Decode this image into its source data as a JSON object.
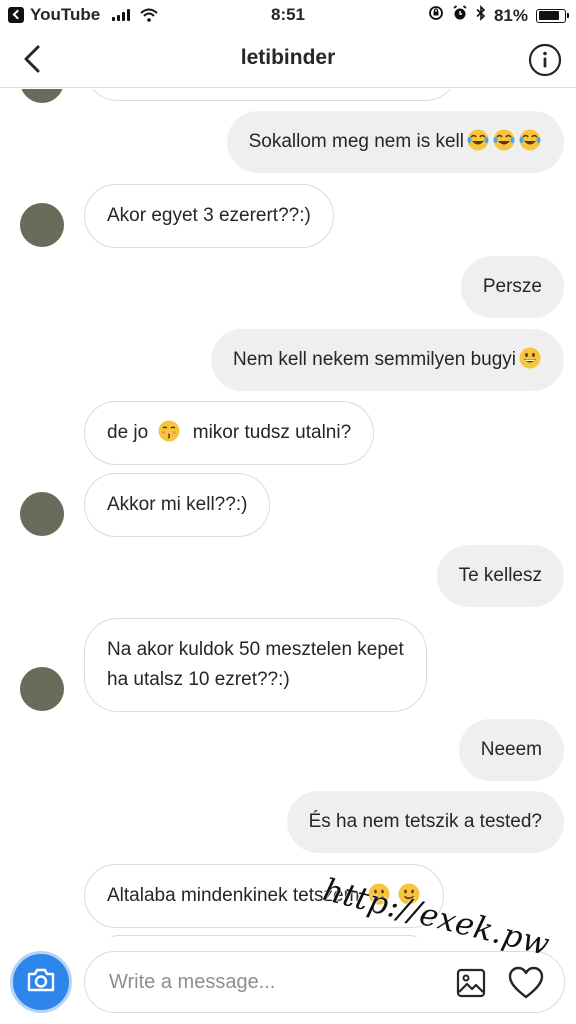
{
  "status_bar": {
    "back_app": "YouTube",
    "time": "8:51",
    "battery_percent": "81%",
    "battery_level": 0.81,
    "icons": [
      "signal-icon",
      "wifi-icon",
      "rotation-lock-icon",
      "alarm-icon",
      "bluetooth-icon",
      "battery-icon"
    ]
  },
  "header": {
    "title": "letibinder",
    "back_icon": "chevron-left-icon",
    "info_icon": "info-icon"
  },
  "messages": [
    {
      "side": "out",
      "text": "Sokallom meg nem is kell",
      "emoji": [
        "tears-of-joy-emoji",
        "tears-of-joy-emoji",
        "tears-of-joy-emoji"
      ]
    },
    {
      "side": "in",
      "text": "Akor egyet 3 ezerert??:)"
    },
    {
      "side": "out",
      "text": "Persze"
    },
    {
      "side": "out",
      "text": "Nem kell nekem semmilyen bugyi",
      "emoji": [
        "grinning-emoji"
      ]
    },
    {
      "side": "in",
      "text_before": "de jo ",
      "emoji": [
        "kissing-emoji"
      ],
      "text_after": " mikor tudsz utalni?"
    },
    {
      "side": "in",
      "text": "Akkor mi kell??:)"
    },
    {
      "side": "out",
      "text": "Te kellesz"
    },
    {
      "side": "in",
      "line1": "Na akor kuldok 50 mesztelen kepet",
      "line2": "ha utalsz 10 ezret??:)"
    },
    {
      "side": "out",
      "text": "Neeem"
    },
    {
      "side": "out",
      "text": "És ha nem tetszik a tested?"
    },
    {
      "side": "in",
      "text": "Altalaba mindenkinek tetszem",
      "emoji": [
        "slightly-smiling-emoji",
        "slightly-smiling-emoji"
      ]
    }
  ],
  "watermark": "http://exek.pw",
  "composer": {
    "placeholder": "Write a message...",
    "camera_icon": "camera-icon",
    "gallery_icon": "image-gallery-icon",
    "like_icon": "heart-icon"
  },
  "colors": {
    "accent_blue": "#2f86ea",
    "incoming_bubble_border": "#dbdbdb",
    "outgoing_bubble": "#efefef"
  }
}
